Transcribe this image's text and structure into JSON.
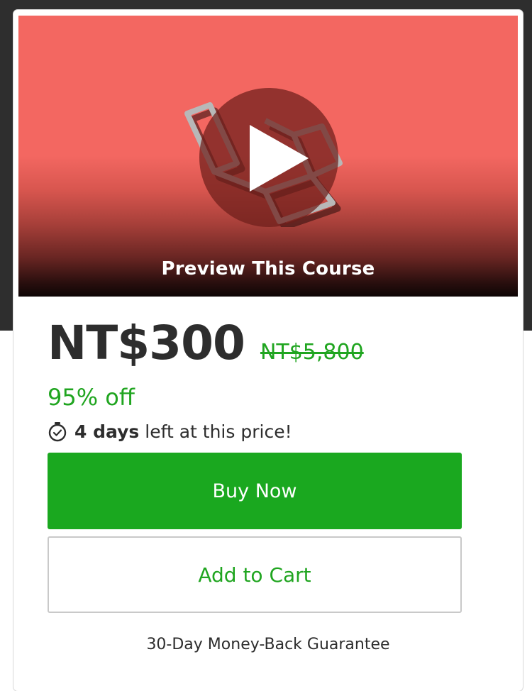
{
  "preview": {
    "label": "Preview This Course",
    "background_color": "#f36761",
    "play_icon": "play-icon",
    "logo_icon": "laravel-logo"
  },
  "pricing": {
    "current_price": "NT$300",
    "original_price": "NT$5,800",
    "discount": "95% off",
    "countdown_days": "4 days",
    "countdown_suffix": "left at this price!",
    "timer_icon": "stopwatch-icon"
  },
  "actions": {
    "buy_now_label": "Buy Now",
    "add_to_cart_label": "Add to Cart"
  },
  "guarantee": "30-Day Money-Back Guarantee",
  "colors": {
    "accent_green": "#1aa81f",
    "text_dark": "#2d2d2d",
    "top_band": "#2e2e2e"
  }
}
